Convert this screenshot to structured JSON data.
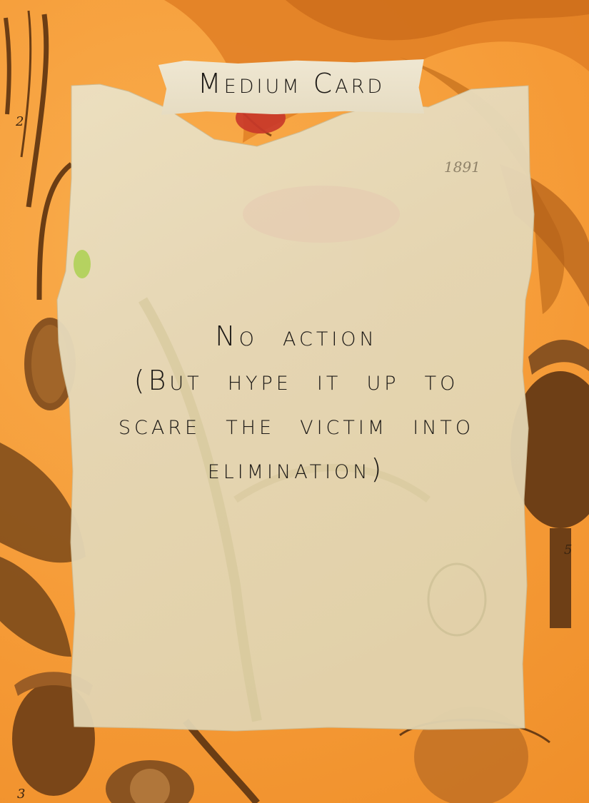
{
  "card": {
    "title": "Medium Card",
    "body_lines": [
      "No action",
      "(But hype it up to",
      "scare the victim into",
      "elimination)"
    ]
  },
  "background": {
    "plate_numbers": [
      "2",
      "3",
      "5"
    ],
    "paper_note": "1891"
  },
  "colors": {
    "background_orange": "#f7a13f",
    "paper": "#e7dcbf",
    "ink": "#1b1815",
    "botanical_brown": "#6b3d14",
    "petal_red": "#c8372a"
  }
}
